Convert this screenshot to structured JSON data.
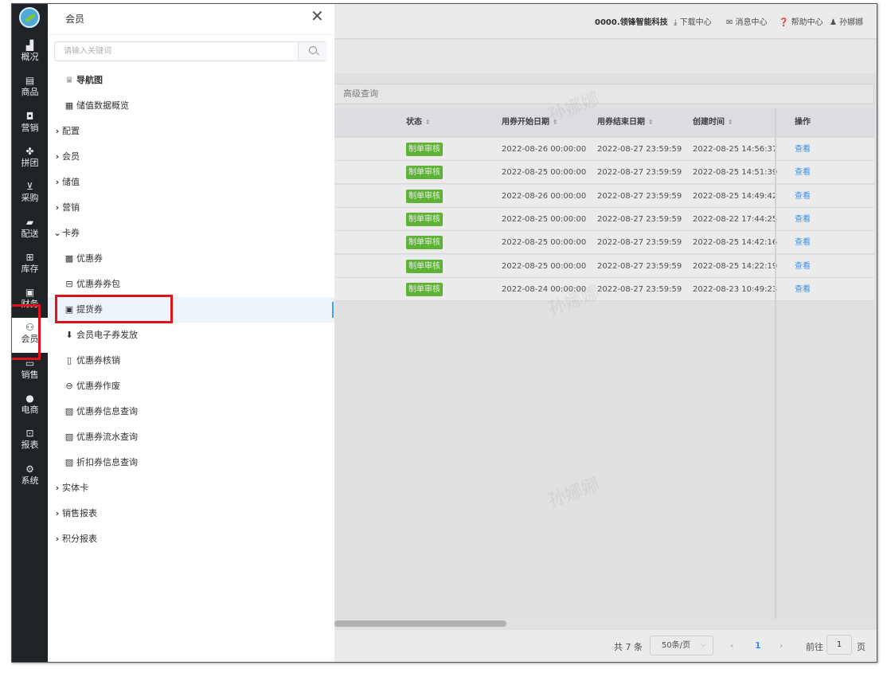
{
  "nav": {
    "items": [
      {
        "label": "概况",
        "icon": "building-icon",
        "glyph": "▟"
      },
      {
        "label": "商品",
        "icon": "document-icon",
        "glyph": "▤"
      },
      {
        "label": "营销",
        "icon": "bag-icon",
        "glyph": "◘"
      },
      {
        "label": "拼团",
        "icon": "grid-icon",
        "glyph": "✤"
      },
      {
        "label": "采购",
        "icon": "cart-icon",
        "glyph": "⊻"
      },
      {
        "label": "配送",
        "icon": "truck-icon",
        "glyph": "▰"
      },
      {
        "label": "库存",
        "icon": "box-icon",
        "glyph": "⊞"
      },
      {
        "label": "财务",
        "icon": "wallet-icon",
        "glyph": "▣"
      },
      {
        "label": "会员",
        "icon": "user-icon",
        "glyph": "⚇",
        "active": true
      },
      {
        "label": "销售",
        "icon": "monitor-icon",
        "glyph": "▭"
      },
      {
        "label": "电商",
        "icon": "person-icon",
        "glyph": "●"
      },
      {
        "label": "报表",
        "icon": "board-icon",
        "glyph": "⊡"
      },
      {
        "label": "系统",
        "icon": "settings-icon",
        "glyph": "⚙"
      }
    ]
  },
  "panel": {
    "title": "会员",
    "close_glyph": "✕",
    "search_placeholder": "请输入关键词",
    "items": [
      {
        "label": "导航图",
        "icon": "navigation-map-icon",
        "glyph": "♕",
        "type": "link",
        "bold": true
      },
      {
        "label": "储值数据概览",
        "icon": "chart-icon",
        "glyph": "▦",
        "type": "link"
      },
      {
        "label": "配置",
        "type": "group",
        "glyph": "›"
      },
      {
        "label": "会员",
        "type": "group",
        "glyph": "›"
      },
      {
        "label": "储值",
        "type": "group",
        "glyph": "›"
      },
      {
        "label": "营销",
        "type": "group",
        "glyph": "›"
      },
      {
        "label": "卡券",
        "type": "group",
        "glyph": "⌄",
        "expanded": true
      },
      {
        "label": "优惠券",
        "icon": "coupon-icon",
        "glyph": "▩",
        "type": "link"
      },
      {
        "label": "优惠券券包",
        "icon": "coupon-pack-icon",
        "glyph": "⊟",
        "type": "link"
      },
      {
        "label": "提货券",
        "icon": "pickup-voucher-icon",
        "glyph": "▣",
        "type": "link",
        "selected": true
      },
      {
        "label": "会员电子券发放",
        "icon": "download-icon",
        "glyph": "⬇",
        "type": "link"
      },
      {
        "label": "优惠券核销",
        "icon": "phone-icon",
        "glyph": "▯",
        "type": "link"
      },
      {
        "label": "优惠券作废",
        "icon": "minus-circle-icon",
        "glyph": "⊖",
        "type": "link"
      },
      {
        "label": "优惠券信息查询",
        "icon": "calendar-icon",
        "glyph": "▨",
        "type": "link"
      },
      {
        "label": "优惠券流水查询",
        "icon": "calendar-icon",
        "glyph": "▨",
        "type": "link"
      },
      {
        "label": "折扣券信息查询",
        "icon": "calendar-icon",
        "glyph": "▨",
        "type": "link"
      },
      {
        "label": "实体卡",
        "type": "group",
        "glyph": "›"
      },
      {
        "label": "销售报表",
        "type": "group",
        "glyph": "›"
      },
      {
        "label": "积分报表",
        "type": "group",
        "glyph": "›"
      }
    ]
  },
  "topbar": {
    "company": "0000.领锋智能科技",
    "download": "⤓ 下载中心",
    "message": "✉ 消息中心",
    "help": "❓ 帮助中心",
    "user": "♟ 孙娜娜"
  },
  "query": {
    "advanced": "高级查询"
  },
  "table": {
    "columns": [
      "状态",
      "用券开始日期",
      "用券结束日期",
      "创建时间",
      "操作"
    ],
    "sort_glyph": "⇕",
    "rows": [
      {
        "status": "制单审核",
        "start": "2022-08-26 00:00:00",
        "end": "2022-08-27 23:59:59",
        "created": "2022-08-25 14:56:37",
        "action": "查看"
      },
      {
        "status": "制单审核",
        "start": "2022-08-25 00:00:00",
        "end": "2022-08-27 23:59:59",
        "created": "2022-08-25 14:51:39",
        "action": "查看"
      },
      {
        "status": "制单审核",
        "start": "2022-08-26 00:00:00",
        "end": "2022-08-27 23:59:59",
        "created": "2022-08-25 14:49:42",
        "action": "查看"
      },
      {
        "status": "制单审核",
        "start": "2022-08-25 00:00:00",
        "end": "2022-08-27 23:59:59",
        "created": "2022-08-22 17:44:25",
        "action": "查看"
      },
      {
        "status": "制单审核",
        "start": "2022-08-25 00:00:00",
        "end": "2022-08-27 23:59:59",
        "created": "2022-08-25 14:42:16",
        "action": "查看"
      },
      {
        "status": "制单审核",
        "start": "2022-08-25 00:00:00",
        "end": "2022-08-27 23:59:59",
        "created": "2022-08-25 14:22:19",
        "action": "查看"
      },
      {
        "status": "制单审核",
        "start": "2022-08-24 00:00:00",
        "end": "2022-08-27 23:59:59",
        "created": "2022-08-23 10:49:23",
        "action": "查看"
      }
    ]
  },
  "pager": {
    "total": "共 7 条",
    "page_size": "50条/页",
    "prev": "‹",
    "current": "1",
    "next": "›",
    "goto_label": "前往",
    "goto_value": "1",
    "page_suffix": "页"
  },
  "watermark": "孙娜娜",
  "colors": {
    "accent": "#409eff",
    "status_green": "#67c23a",
    "highlight_red": "#e0131a",
    "nav_bg": "#1f2327"
  }
}
